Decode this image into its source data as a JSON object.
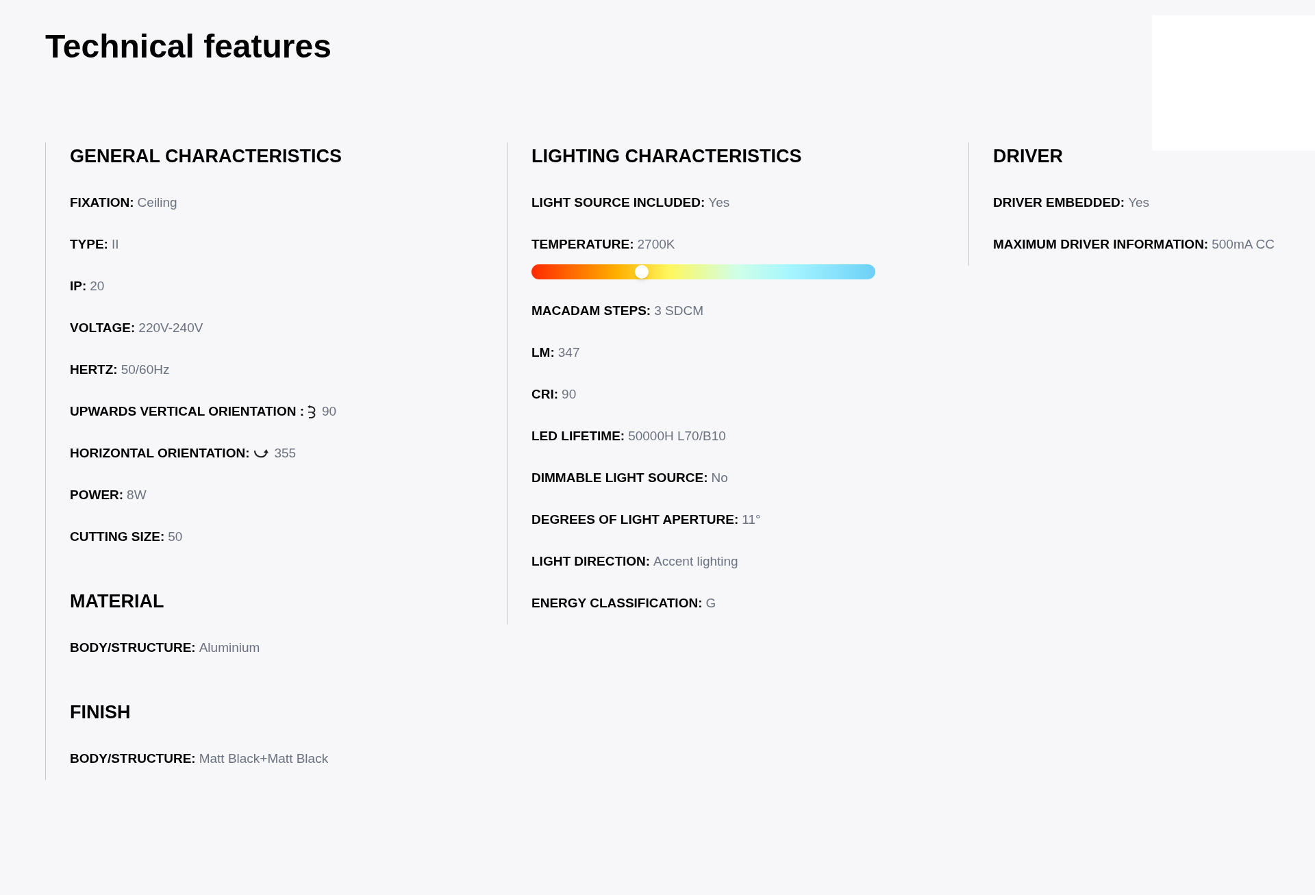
{
  "title": "Technical features",
  "columns": [
    {
      "sections": [
        {
          "heading": "GENERAL CHARACTERISTICS",
          "items": [
            {
              "kind": "plain",
              "label": "FIXATION:",
              "value": "Ceiling"
            },
            {
              "kind": "plain",
              "label": "TYPE:",
              "value": "II"
            },
            {
              "kind": "plain",
              "label": "IP:",
              "value": "20"
            },
            {
              "kind": "plain",
              "label": "VOLTAGE:",
              "value": "220V-240V"
            },
            {
              "kind": "plain",
              "label": "HERTZ:",
              "value": "50/60Hz"
            },
            {
              "kind": "vertical",
              "label": "UPWARDS VERTICAL ORIENTATION :",
              "value": "90"
            },
            {
              "kind": "horizontal",
              "label": "HORIZONTAL ORIENTATION:",
              "value": "355"
            },
            {
              "kind": "plain",
              "label": "POWER:",
              "value": "8W"
            },
            {
              "kind": "plain",
              "label": "CUTTING SIZE:",
              "value": "50"
            }
          ]
        },
        {
          "heading": "MATERIAL",
          "items": [
            {
              "kind": "plain",
              "label": "BODY/STRUCTURE:",
              "value": "Aluminium"
            }
          ]
        },
        {
          "heading": "FINISH",
          "items": [
            {
              "kind": "plain",
              "label": "BODY/STRUCTURE:",
              "value": "Matt Black+Matt Black"
            }
          ]
        }
      ]
    },
    {
      "sections": [
        {
          "heading": "LIGHTING CHARACTERISTICS",
          "items": [
            {
              "kind": "plain",
              "label": "LIGHT SOURCE INCLUDED:",
              "value": "Yes"
            },
            {
              "kind": "slider",
              "label": "TEMPERATURE:",
              "value": "2700K",
              "level": 0.32
            },
            {
              "kind": "plain",
              "label": "MACADAM STEPS:",
              "value": "3 SDCM"
            },
            {
              "kind": "plain",
              "label": "LM:",
              "value": "347"
            },
            {
              "kind": "plain",
              "label": "CRI:",
              "value": "90"
            },
            {
              "kind": "plain",
              "label": "LED LIFETIME:",
              "value": "50000H L70/B10"
            },
            {
              "kind": "plain",
              "label": "DIMMABLE LIGHT SOURCE:",
              "value": "No"
            },
            {
              "kind": "plain",
              "label": "DEGREES OF LIGHT APERTURE:",
              "value": "11°"
            },
            {
              "kind": "plain",
              "label": "LIGHT DIRECTION:",
              "value": "Accent lighting"
            },
            {
              "kind": "plain",
              "label": "ENERGY CLASSIFICATION:",
              "value": "G"
            }
          ]
        }
      ]
    },
    {
      "sections": [
        {
          "heading": "DRIVER",
          "items": [
            {
              "kind": "plain",
              "label": "DRIVER EMBEDDED:",
              "value": "Yes"
            },
            {
              "kind": "plain",
              "label": "MAXIMUM DRIVER INFORMATION:",
              "value": "500mA CC"
            }
          ]
        }
      ]
    }
  ]
}
